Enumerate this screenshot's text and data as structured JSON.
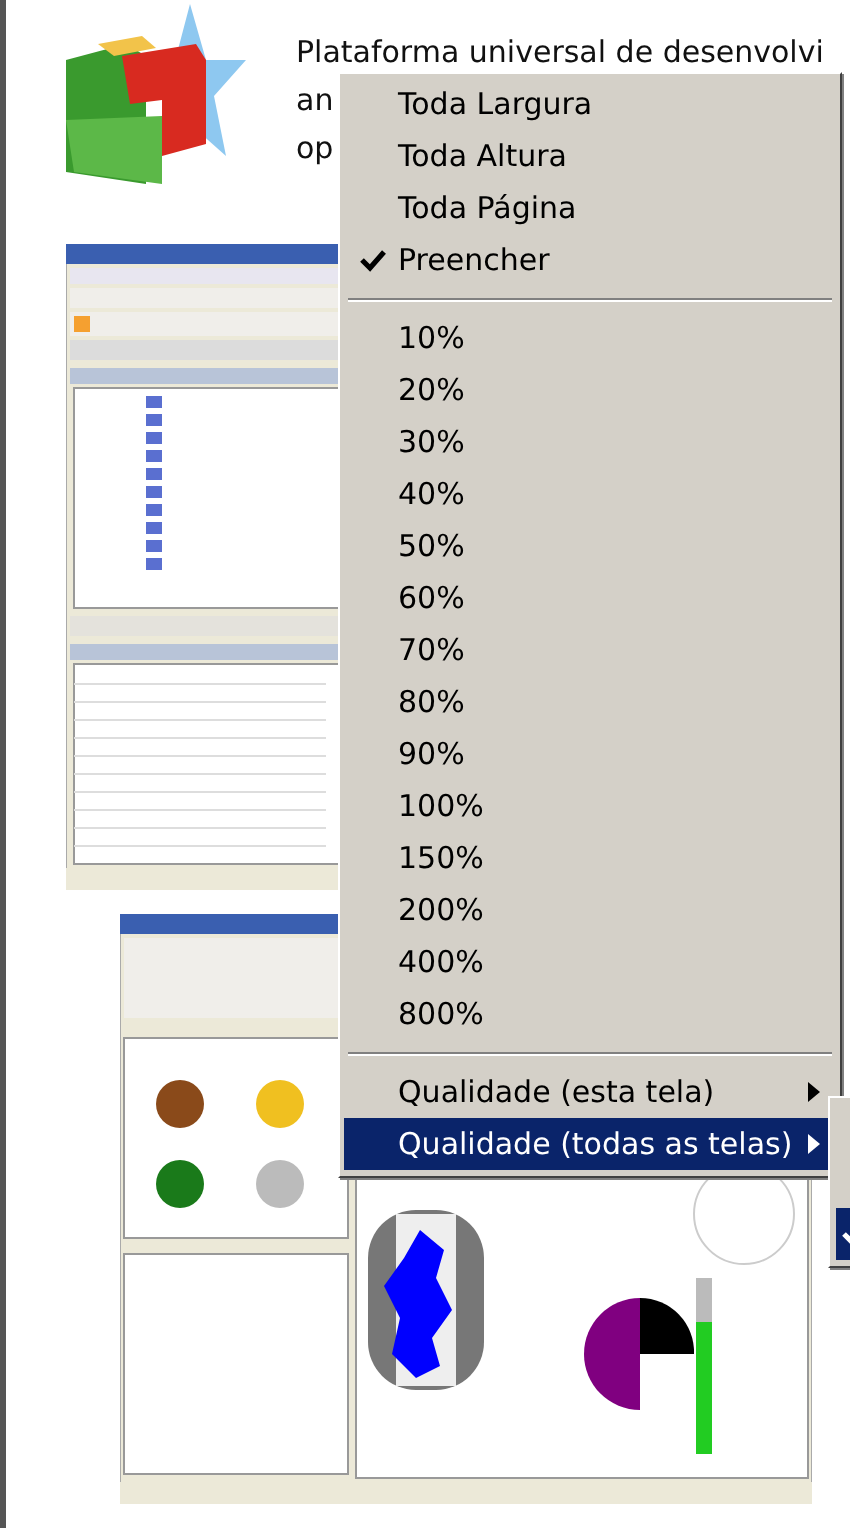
{
  "document": {
    "paragraph_lines": [
      "Plataforma universal de desenvolvi",
      "an",
      "op"
    ]
  },
  "context_menu": {
    "items": [
      {
        "kind": "option",
        "label": "Toda Largura",
        "checked": false,
        "selected": false
      },
      {
        "kind": "option",
        "label": "Toda Altura",
        "checked": false,
        "selected": false
      },
      {
        "kind": "option",
        "label": "Toda Página",
        "checked": false,
        "selected": false
      },
      {
        "kind": "option",
        "label": "Preencher",
        "checked": true,
        "selected": false
      },
      {
        "kind": "separator"
      },
      {
        "kind": "option",
        "label": "10%",
        "checked": false,
        "selected": false
      },
      {
        "kind": "option",
        "label": "20%",
        "checked": false,
        "selected": false
      },
      {
        "kind": "option",
        "label": "30%",
        "checked": false,
        "selected": false
      },
      {
        "kind": "option",
        "label": "40%",
        "checked": false,
        "selected": false
      },
      {
        "kind": "option",
        "label": "50%",
        "checked": false,
        "selected": false
      },
      {
        "kind": "option",
        "label": "60%",
        "checked": false,
        "selected": false
      },
      {
        "kind": "option",
        "label": "70%",
        "checked": false,
        "selected": false
      },
      {
        "kind": "option",
        "label": "80%",
        "checked": false,
        "selected": false
      },
      {
        "kind": "option",
        "label": "90%",
        "checked": false,
        "selected": false
      },
      {
        "kind": "option",
        "label": "100%",
        "checked": false,
        "selected": false
      },
      {
        "kind": "option",
        "label": "150%",
        "checked": false,
        "selected": false
      },
      {
        "kind": "option",
        "label": "200%",
        "checked": false,
        "selected": false
      },
      {
        "kind": "option",
        "label": "400%",
        "checked": false,
        "selected": false
      },
      {
        "kind": "option",
        "label": "800%",
        "checked": false,
        "selected": false
      },
      {
        "kind": "separator"
      },
      {
        "kind": "submenu",
        "label": "Qualidade (esta tela)",
        "selected": false
      },
      {
        "kind": "submenu",
        "label": "Qualidade (todas as telas)",
        "selected": true
      }
    ]
  },
  "submenu": {
    "items": [
      {
        "checked": true,
        "selected": true
      }
    ]
  }
}
